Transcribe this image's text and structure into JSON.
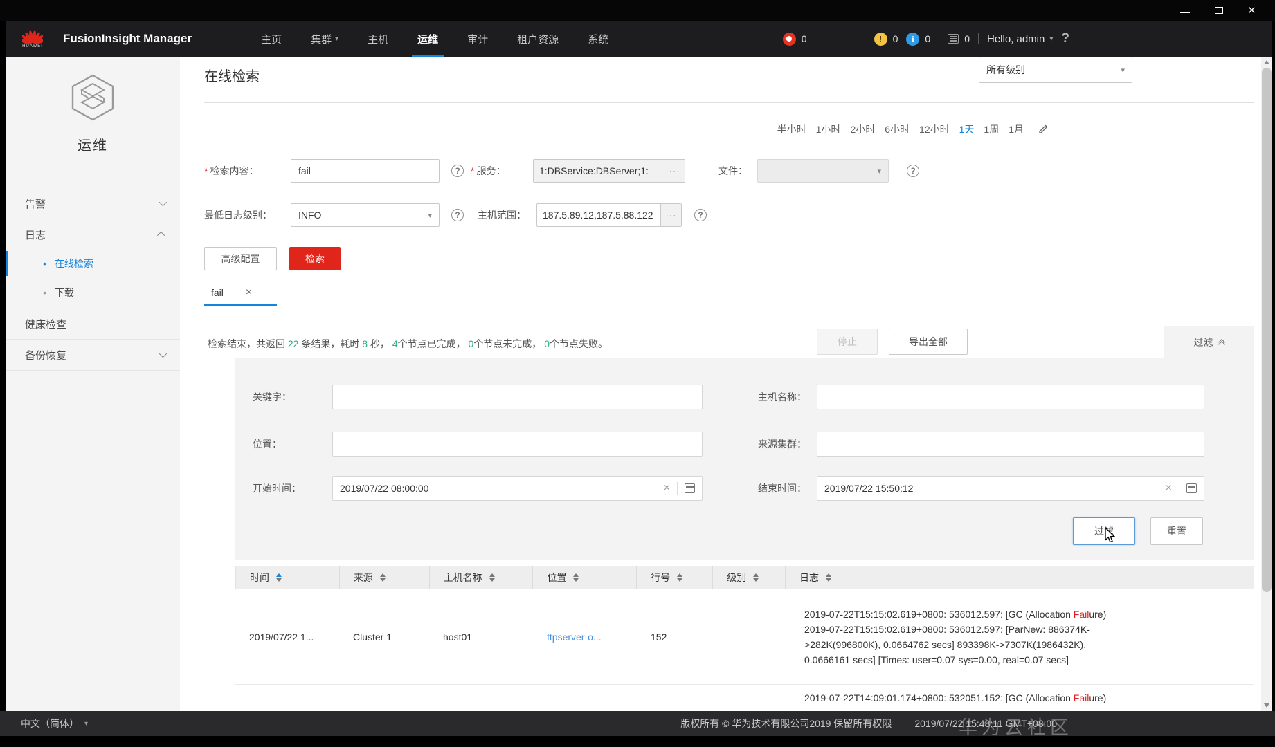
{
  "colors": {
    "accent_blue": "#1584dc",
    "huawei_red": "#e0251b",
    "link_blue": "#4a90e2",
    "result_teal": "#2bab87",
    "alarm_red": "#e63222",
    "alarm_yellow": "#f5c342",
    "alarm_blue": "#2d9be8",
    "highlight_red": "#e02020"
  },
  "glyphs": {
    "question": "?",
    "close": "×",
    "more": "···",
    "caret": "▾",
    "bullet": "•",
    "required": "*"
  },
  "topbar": {
    "logo_text": "HUAWEI",
    "brand": "FusionInsight Manager",
    "nav": [
      {
        "label": "主页"
      },
      {
        "label": "集群"
      },
      {
        "label": "主机"
      },
      {
        "label": "运维"
      },
      {
        "label": "审计"
      },
      {
        "label": "租户资源"
      },
      {
        "label": "系统"
      }
    ],
    "alarm_counts": {
      "critical": "0",
      "major": "0",
      "minor": "0",
      "tasks": "0"
    },
    "user_greeting": "Hello, admin"
  },
  "sidebar": {
    "module_title": "运维",
    "items": {
      "alarm": "告警",
      "log": "日志",
      "online_search": "在线检索",
      "download": "下载",
      "health_check": "健康检查",
      "backup_restore": "备份恢复"
    }
  },
  "page": {
    "title": "在线检索",
    "time_ranges": [
      "半小时",
      "1小时",
      "2小时",
      "6小时",
      "12小时",
      "1天",
      "1周",
      "1月"
    ],
    "form": {
      "search_label": "检索内容：",
      "search_value": "fail",
      "service_label": "服务：",
      "service_value": "1:DBService:DBServer;1:",
      "file_label": "文件：",
      "file_value": "",
      "level_label": "最低日志级别：",
      "level_value": "INFO",
      "host_label": "主机范围：",
      "host_value": "187.5.89.12,187.5.88.122",
      "advanced_button": "高级配置",
      "search_button": "检索"
    },
    "tab_label": "fail",
    "result": {
      "t0": "检索结束，共返回 ",
      "n0": "22",
      "t1": " 条结果，耗时 ",
      "n1": "8",
      "t2": " 秒， ",
      "n2": "4",
      "t3": "个节点已完成， ",
      "n3": "0",
      "t4": "个节点未完成， ",
      "n4": "0",
      "t5": "个节点失败。",
      "stop_button": "停止",
      "export_button": "导出全部",
      "level_filter": "所有级别",
      "filter_toggle": "过滤"
    },
    "filter": {
      "keyword_label": "关键字：",
      "keyword_value": "",
      "hostname_label": "主机名称：",
      "hostname_value": "",
      "location_label": "位置：",
      "location_value": "",
      "cluster_label": "来源集群：",
      "cluster_value": "",
      "start_label": "开始时间：",
      "start_value": "2019/07/22 08:00:00",
      "end_label": "结束时间：",
      "end_value": "2019/07/22 15:50:12",
      "filter_button": "过滤",
      "reset_button": "重置"
    },
    "table": {
      "columns": [
        "时间",
        "来源",
        "主机名称",
        "位置",
        "行号",
        "级别",
        "日志"
      ],
      "row1": {
        "time": "2019/07/22 1...",
        "source": "Cluster 1",
        "host": "host01",
        "location": "ftpserver-o...",
        "line_no": "152",
        "level": "",
        "log_line1_a": "2019-07-22T15:15:02.619+0800: 536012.597: [GC (Allocation ",
        "log_line1_b": "Fail",
        "log_line1_c": "ure)",
        "log_line2": "2019-07-22T15:15:02.619+0800: 536012.597: [ParNew: 886374K-",
        "log_line3": ">282K(996800K), 0.0664762 secs] 893398K->7307K(1986432K),",
        "log_line4": "0.0666161 secs] [Times: user=0.07 sys=0.00, real=0.07 secs]"
      },
      "row2": {
        "log_line1_a": "2019-07-22T14:09:01.174+0800: 532051.152: [GC (Allocation ",
        "log_line1_b": "Fail",
        "log_line1_c": "ure)"
      }
    }
  },
  "footer": {
    "language": "中文（简体）",
    "copyright": "版权所有 © 华为技术有限公司2019 保留所有权限",
    "datetime": "2019/07/22 15:48:11 GMT+08:00",
    "watermark": "华为云社区"
  }
}
